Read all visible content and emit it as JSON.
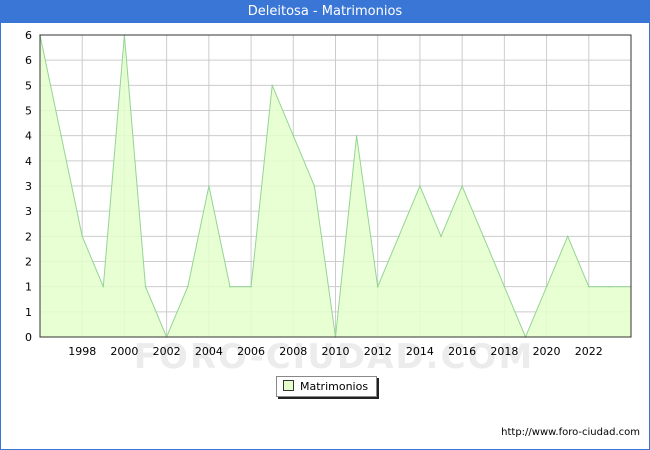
{
  "title": "Deleitosa - Matrimonios",
  "source": "http://www.foro-ciudad.com",
  "watermark": "FORO-CIUDAD.COM",
  "colors": {
    "header": "#3a76d6",
    "fill": "#e4ffcc",
    "line": "#94d494",
    "grid": "#cccccc",
    "watermark": "#ececec"
  },
  "chart_data": {
    "type": "area",
    "title": "Deleitosa - Matrimonios",
    "x": [
      1996,
      1997,
      1998,
      1999,
      2000,
      2001,
      2002,
      2003,
      2004,
      2005,
      2006,
      2007,
      2008,
      2009,
      2010,
      2011,
      2012,
      2013,
      2014,
      2015,
      2016,
      2017,
      2018,
      2019,
      2020,
      2021,
      2022,
      2023
    ],
    "series": [
      {
        "name": "Matrimonios",
        "values": [
          6,
          4,
          2,
          1,
          6,
          1,
          0,
          1,
          3,
          1,
          1,
          5,
          4,
          3,
          0,
          4,
          1,
          2,
          3,
          2,
          3,
          2,
          1,
          0,
          1,
          2,
          1,
          1
        ]
      }
    ],
    "x_ticks": [
      "1998",
      "2000",
      "2002",
      "2004",
      "2006",
      "2008",
      "2010",
      "2012",
      "2014",
      "2016",
      "2018",
      "2020",
      "2022"
    ],
    "y_tick_labels": [
      "0",
      "1",
      "1",
      "2",
      "2",
      "3",
      "3",
      "4",
      "4",
      "5",
      "5",
      "6",
      "6"
    ],
    "xlim": [
      1996,
      2024
    ],
    "ylim": [
      0,
      6
    ],
    "grid": true,
    "legend": "bottom-center"
  }
}
